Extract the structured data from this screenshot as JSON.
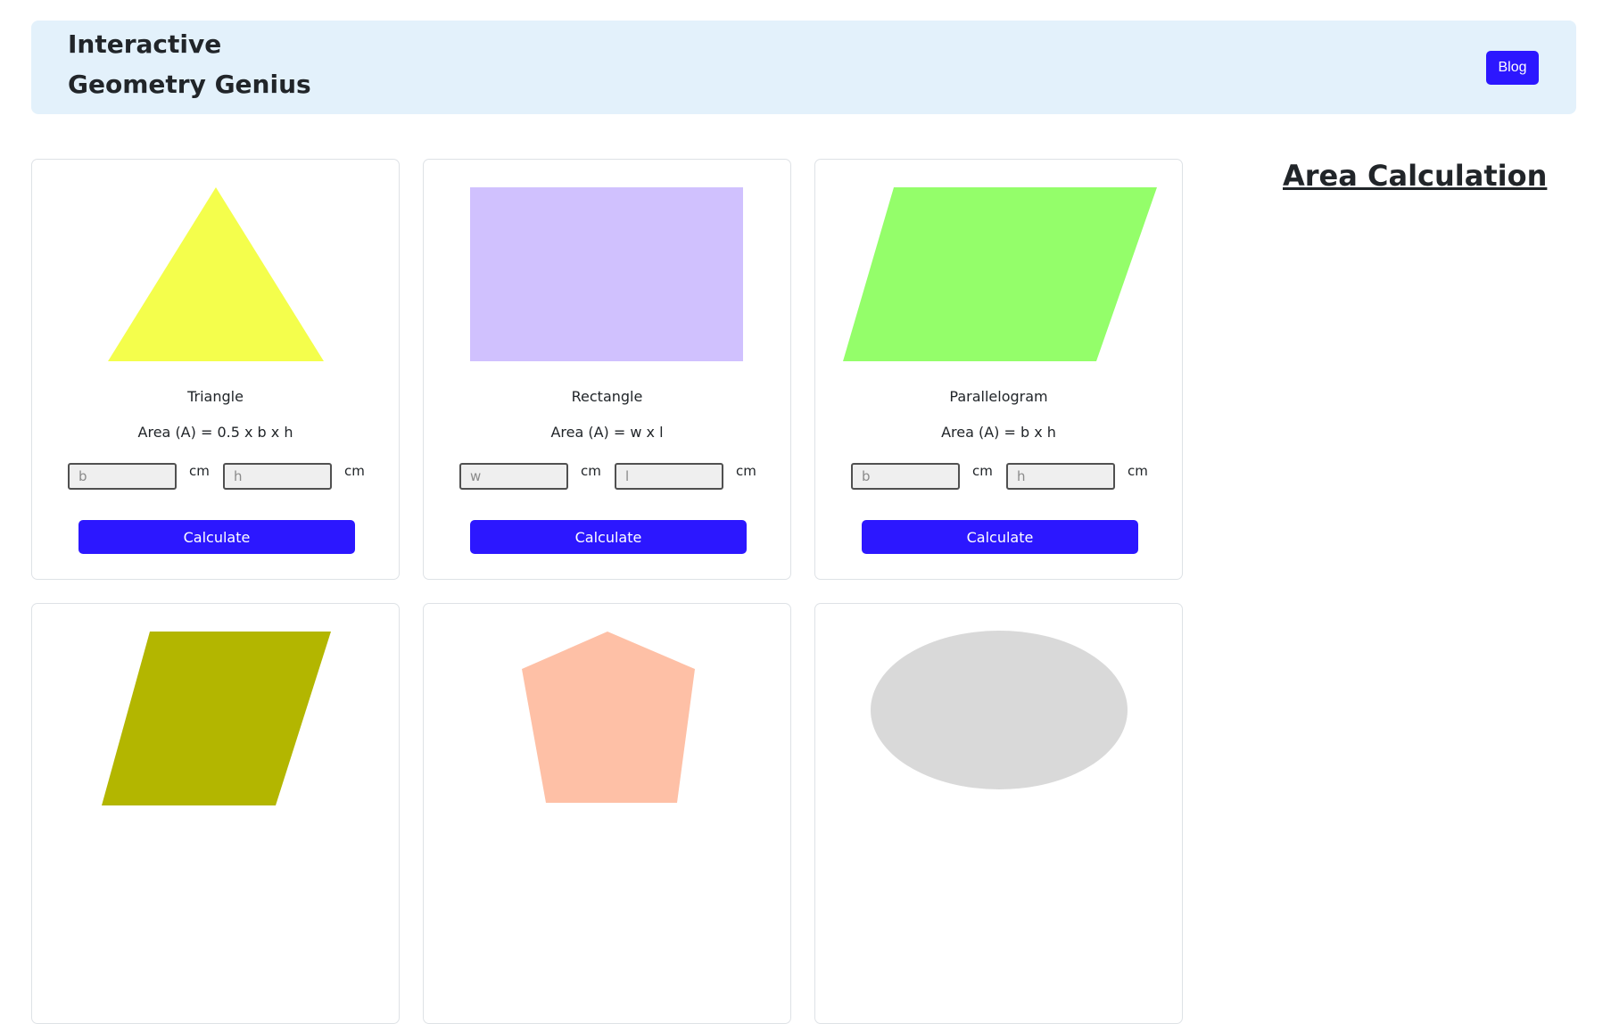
{
  "header": {
    "brand_line1": "Interactive",
    "brand_line2": "Geometry Genius",
    "blog_label": "Blog"
  },
  "side": {
    "heading": "Area Calculation"
  },
  "colors": {
    "accent": "#2c17ff",
    "navbar_bg": "#e3f1fb",
    "triangle": "#f4fe4c",
    "rectangle": "#d0c1fe",
    "parallelogram": "#94fe6a",
    "rhombus": "#b3b600",
    "pentagon": "#fec0a6",
    "ellipse": "#d9d9d9"
  },
  "cards": [
    {
      "shape_icon": "triangle-shape",
      "name": "Triangle",
      "formula": "Area (A) = 0.5 x b x h",
      "input1_placeholder": "b",
      "input2_placeholder": "h",
      "unit1": "cm",
      "unit2": "cm",
      "button": "Calculate"
    },
    {
      "shape_icon": "rectangle-shape",
      "name": "Rectangle",
      "formula": "Area (A) = w x l",
      "input1_placeholder": "w",
      "input2_placeholder": "l",
      "unit1": "cm",
      "unit2": "cm",
      "button": "Calculate"
    },
    {
      "shape_icon": "parallelogram-shape",
      "name": "Parallelogram",
      "formula": "Area (A) = b x h",
      "input1_placeholder": "b",
      "input2_placeholder": "h",
      "unit1": "cm",
      "unit2": "cm",
      "button": "Calculate"
    },
    {
      "shape_icon": "rhombus-shape"
    },
    {
      "shape_icon": "pentagon-shape"
    },
    {
      "shape_icon": "ellipse-shape"
    }
  ]
}
